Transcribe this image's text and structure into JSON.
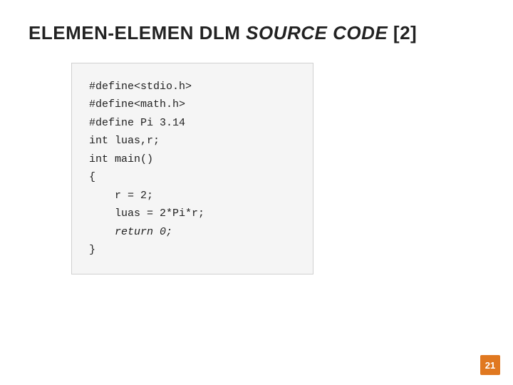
{
  "title": {
    "prefix": "ELEMEN-ELEMEN DLM ",
    "italic": "SOURCE CODE",
    "suffix": " [2]"
  },
  "code": {
    "lines": [
      "#define<stdio.h>",
      "#define<math.h>",
      "#define Pi 3.14",
      "int luas,r;",
      "int main()",
      "{",
      "    r = 2;",
      "    luas = 2*Pi*r;",
      "    return 0;",
      "}"
    ],
    "italic_lines": [
      8,
      9
    ]
  },
  "page_number": "21",
  "accent_color": "#e07820"
}
